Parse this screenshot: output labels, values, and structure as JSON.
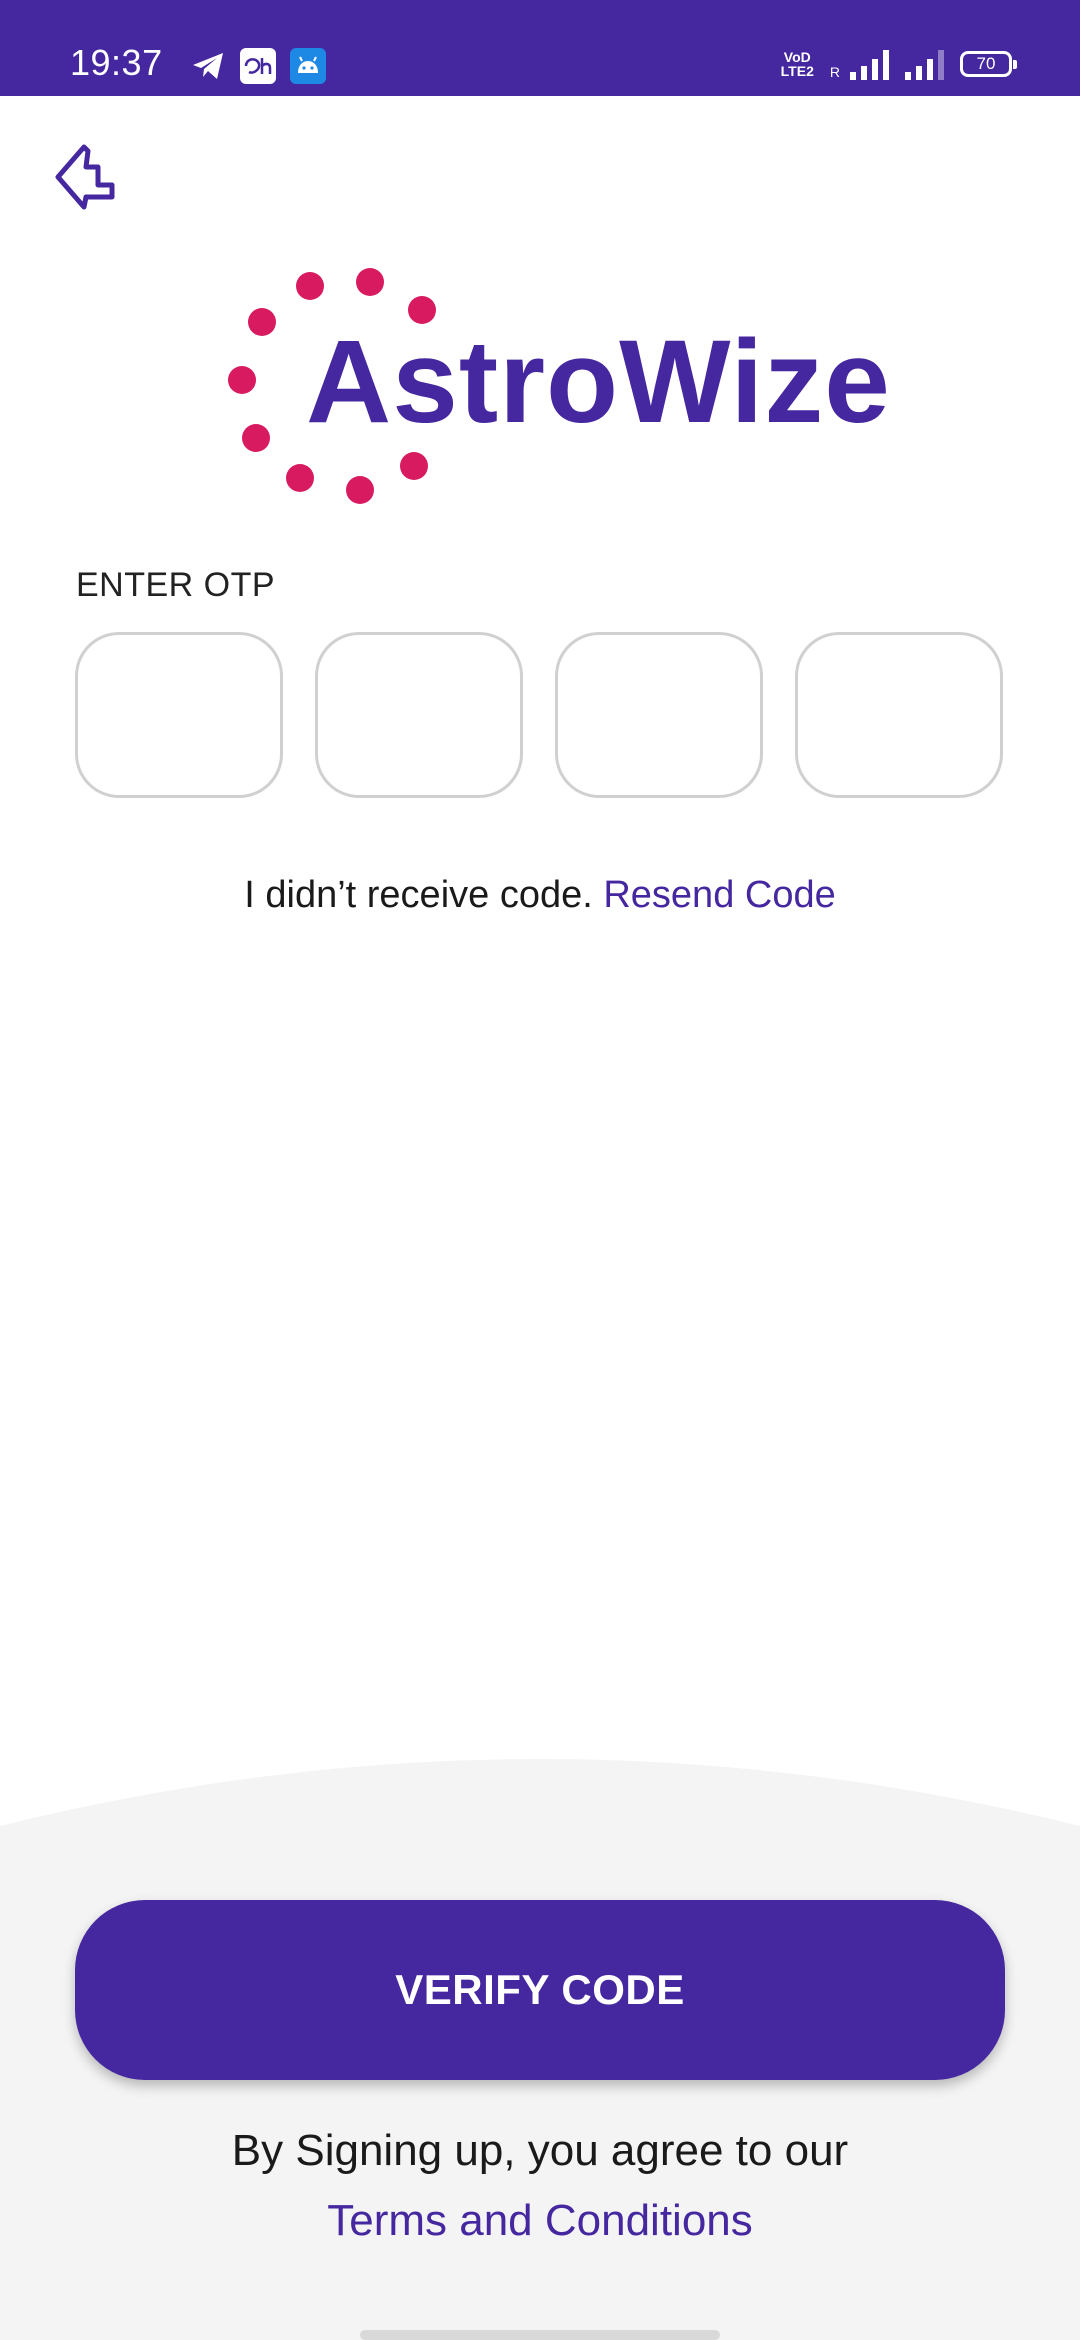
{
  "status_bar": {
    "time": "19:37",
    "icons": [
      "telegram-icon",
      "disney-hotstar-icon",
      "android-icon"
    ],
    "volte_top": "VoD",
    "volte_bottom": "LTE2",
    "roaming": "R",
    "battery": "70"
  },
  "header": {
    "back_icon": "back-arrow-icon"
  },
  "logo": {
    "text": "AstroWize",
    "dot_color": "#D81B60",
    "text_color": "#4527A0"
  },
  "otp": {
    "label": "ENTER OTP",
    "digits": [
      "",
      "",
      "",
      ""
    ]
  },
  "resend": {
    "prompt": "I didn’t receive code.",
    "link": "Resend Code"
  },
  "footer": {
    "verify_label": "VERIFY CODE",
    "agree_text": "By Signing up, you agree to our",
    "terms_link": "Terms and Conditions"
  },
  "colors": {
    "primary": "#4527A0",
    "accent": "#D81B60",
    "background": "#FFFFFF",
    "sheet": "#F4F4F4"
  }
}
